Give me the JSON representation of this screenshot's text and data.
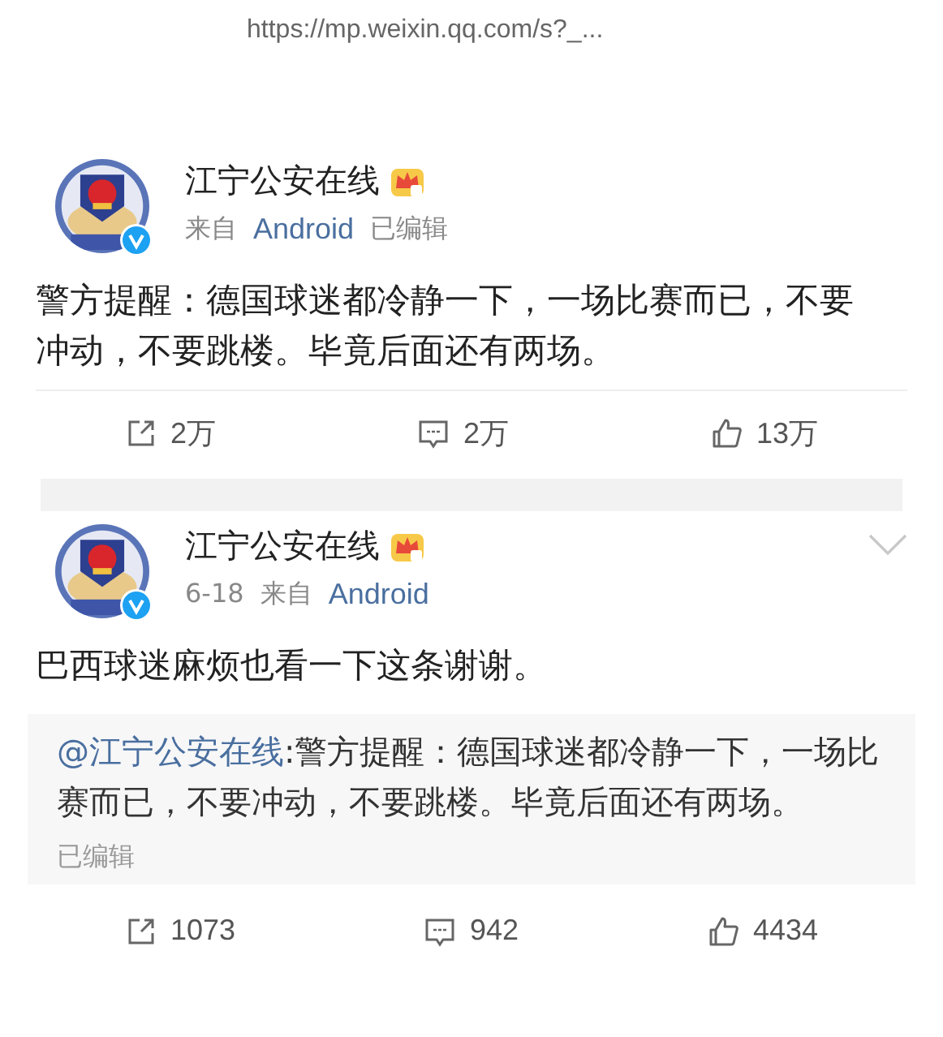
{
  "url": "https://mp.weixin.qq.com/s?_...",
  "posts": [
    {
      "author": "江宁公安在线",
      "meta": [
        {
          "kind": "plain",
          "text": "来自"
        },
        {
          "kind": "link",
          "text": "Android"
        },
        {
          "kind": "plain",
          "text": "已编辑"
        }
      ],
      "menu": false,
      "text": "警方提醒：德国球迷都冷静一下，一场比赛而已，不要冲动，不要跳楼。毕竟后面还有两场。",
      "actions": {
        "repost": "2万",
        "comment": "2万",
        "like": "13万"
      }
    },
    {
      "author": "江宁公安在线",
      "meta": [
        {
          "kind": "plain",
          "text": "6-18"
        },
        {
          "kind": "plain",
          "text": "来自"
        },
        {
          "kind": "link",
          "text": "Android"
        }
      ],
      "menu": true,
      "text": "巴西球迷麻烦也看一下这条谢谢。",
      "quote": {
        "mention": "@江宁公安在线",
        "text": ":警方提醒：德国球迷都冷静一下，一场比赛而已，不要冲动，不要跳楼。毕竟后面还有两场。",
        "note": "已编辑"
      },
      "actions": {
        "repost": "1073",
        "comment": "942",
        "like": "4434"
      }
    }
  ]
}
